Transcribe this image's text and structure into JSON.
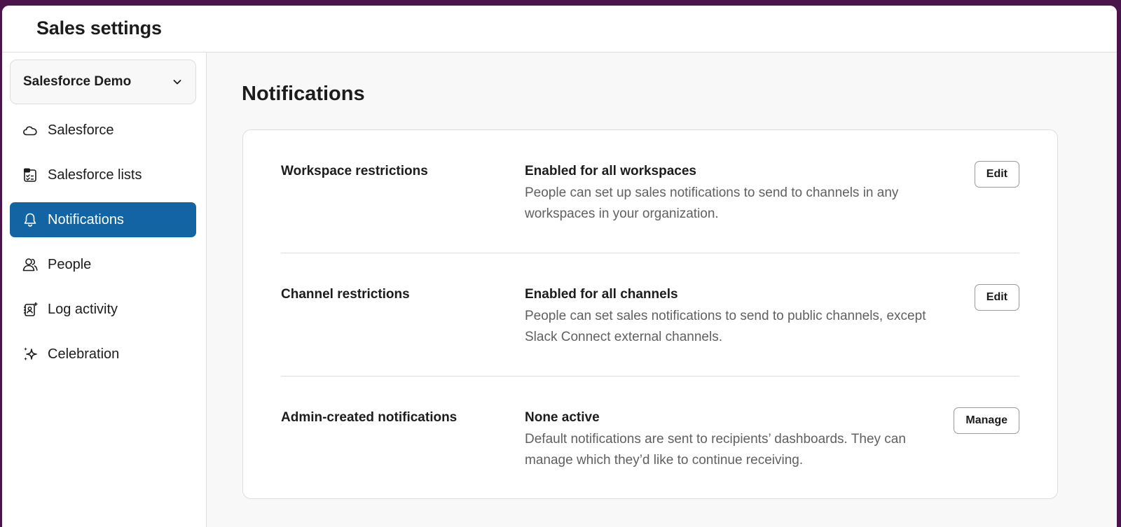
{
  "header": {
    "title": "Sales settings"
  },
  "sidebar": {
    "workspace_select": {
      "label": "Salesforce Demo",
      "icon": "chevron-down-icon"
    },
    "items": [
      {
        "label": "Salesforce",
        "icon": "cloud-icon",
        "active": false
      },
      {
        "label": "Salesforce lists",
        "icon": "list-check-icon",
        "active": false
      },
      {
        "label": "Notifications",
        "icon": "bell-icon",
        "active": true
      },
      {
        "label": "People",
        "icon": "people-icon",
        "active": false
      },
      {
        "label": "Log activity",
        "icon": "contact-add-icon",
        "active": false
      },
      {
        "label": "Celebration",
        "icon": "sparkles-icon",
        "active": false
      }
    ]
  },
  "main": {
    "title": "Notifications",
    "rows": [
      {
        "label": "Workspace restrictions",
        "status": "Enabled for all workspaces",
        "description": "People can set up sales notifications to send to channels in any workspaces in your organization.",
        "button": "Edit"
      },
      {
        "label": "Channel restrictions",
        "status": "Enabled for all channels",
        "description": "People can set sales notifications to send to public channels, except Slack Connect external channels.",
        "button": "Edit"
      },
      {
        "label": "Admin-created notifications",
        "status": "None active",
        "description": "Default notifications are sent to recipients’ dashboards. They can manage which they’d like to continue receiving.",
        "button": "Manage"
      }
    ]
  },
  "colors": {
    "accent": "#1264a3",
    "frame": "#4a154b",
    "muted_text": "#616061"
  }
}
